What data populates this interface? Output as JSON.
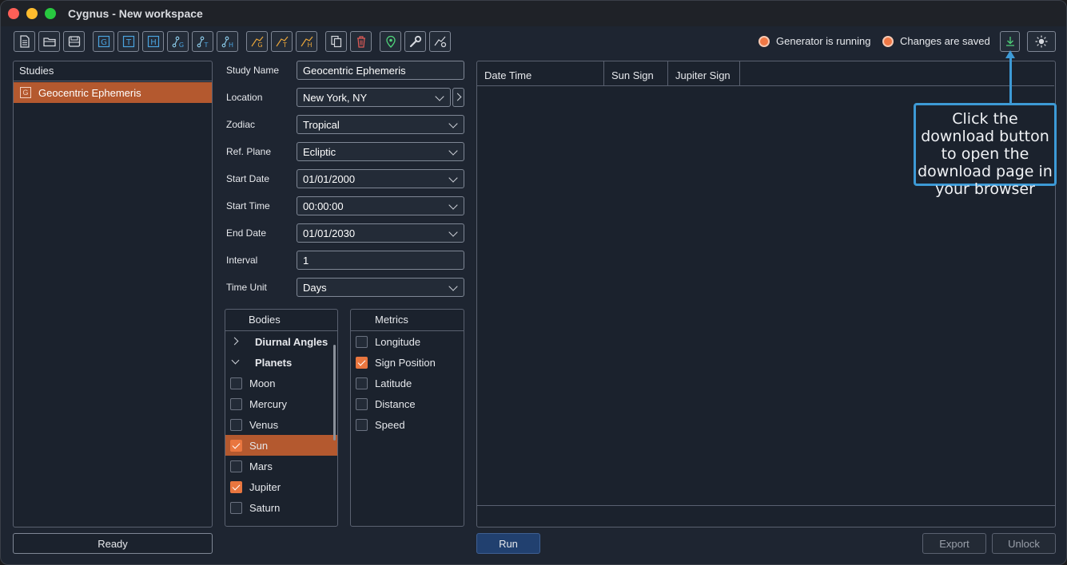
{
  "window": {
    "title": "Cygnus - New workspace"
  },
  "toolbar": {
    "buttons": [
      {
        "name": "new-file-icon"
      },
      {
        "name": "open-folder-icon"
      },
      {
        "name": "save-icon"
      },
      {
        "name": "geocentric-study-icon",
        "glyph": "G"
      },
      {
        "name": "topocentric-study-icon",
        "glyph": "T"
      },
      {
        "name": "heliocentric-study-icon",
        "glyph": "H"
      },
      {
        "name": "geo-chart-icon"
      },
      {
        "name": "topo-chart-icon"
      },
      {
        "name": "helio-chart-icon"
      },
      {
        "name": "geo-aspect-icon"
      },
      {
        "name": "topo-aspect-icon"
      },
      {
        "name": "helio-aspect-icon"
      },
      {
        "name": "copy-icon"
      },
      {
        "name": "delete-icon"
      },
      {
        "name": "location-pin-icon"
      },
      {
        "name": "wrench-icon"
      },
      {
        "name": "chart-settings-icon"
      }
    ]
  },
  "status": {
    "generator": "Generator is running",
    "changes": "Changes are saved"
  },
  "studies": {
    "header": "Studies",
    "items": [
      {
        "glyph": "G",
        "label": "Geocentric Ephemeris"
      }
    ],
    "ready_label": "Ready"
  },
  "form": {
    "study_name_label": "Study Name",
    "study_name_value": "Geocentric Ephemeris",
    "location_label": "Location",
    "location_value": "New York, NY",
    "zodiac_label": "Zodiac",
    "zodiac_value": "Tropical",
    "ref_plane_label": "Ref. Plane",
    "ref_plane_value": "Ecliptic",
    "start_date_label": "Start Date",
    "start_date_value": "01/01/2000",
    "start_time_label": "Start Time",
    "start_time_value": "00:00:00",
    "end_date_label": "End Date",
    "end_date_value": "01/01/2030",
    "interval_label": "Interval",
    "interval_value": "1",
    "time_unit_label": "Time Unit",
    "time_unit_value": "Days"
  },
  "bodies": {
    "header": "Bodies",
    "groups": [
      {
        "label": "Diurnal Angles",
        "expanded": false
      },
      {
        "label": "Planets",
        "expanded": true
      }
    ],
    "items": [
      {
        "label": "Moon",
        "checked": false
      },
      {
        "label": "Mercury",
        "checked": false
      },
      {
        "label": "Venus",
        "checked": false
      },
      {
        "label": "Sun",
        "checked": true,
        "selected": true
      },
      {
        "label": "Mars",
        "checked": false
      },
      {
        "label": "Jupiter",
        "checked": true
      },
      {
        "label": "Saturn",
        "checked": false
      }
    ]
  },
  "metrics": {
    "header": "Metrics",
    "items": [
      {
        "label": "Longitude",
        "checked": false
      },
      {
        "label": "Sign Position",
        "checked": true
      },
      {
        "label": "Latitude",
        "checked": false
      },
      {
        "label": "Distance",
        "checked": false
      },
      {
        "label": "Speed",
        "checked": false
      }
    ]
  },
  "results": {
    "columns": [
      "Date Time",
      "Sun Sign",
      "Jupiter Sign"
    ]
  },
  "actions": {
    "run": "Run",
    "export": "Export",
    "unlock": "Unlock"
  },
  "callout": {
    "text": "Click the download button to open the download page in your browser"
  },
  "colors": {
    "accent": "#b4592f",
    "check": "#e9763f",
    "status_dot": "#f07845",
    "callout": "#3d9ad6",
    "run": "#21406f"
  }
}
